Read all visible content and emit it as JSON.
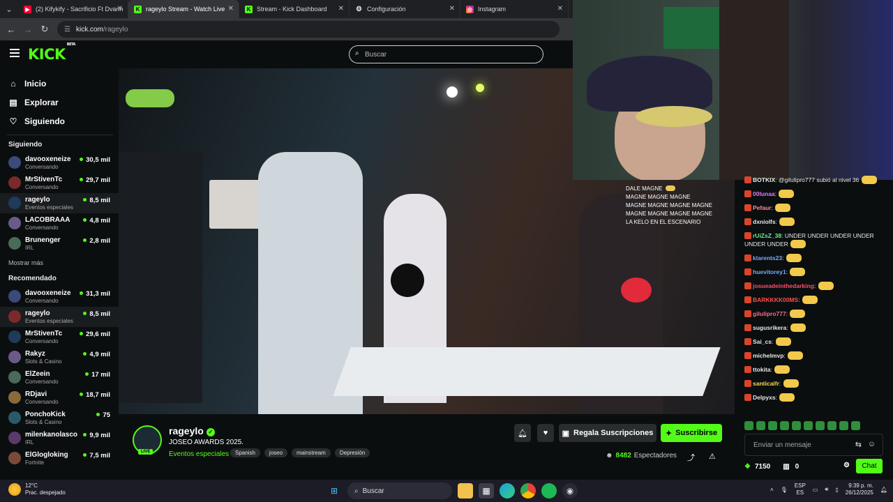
{
  "browser": {
    "tabs": [
      {
        "label": "(2) Kifykify - Sacrificio Ft Dvann",
        "icon": "youtube-icon",
        "color": "#ff0033"
      },
      {
        "label": "rageylo Stream - Watch Live",
        "icon": "kick-icon",
        "color": "#53fc18",
        "active": true
      },
      {
        "label": "Stream - Kick Dashboard",
        "icon": "kick-icon",
        "color": "#53fc18"
      },
      {
        "label": "Configuración",
        "icon": "gear-icon",
        "color": "#e8e8e8"
      },
      {
        "label": "Instagram",
        "icon": "instagram-icon",
        "color": "#e1306c"
      }
    ],
    "url_host": "kick.com",
    "url_path": "/rageylo"
  },
  "kick": {
    "logo": "KICK",
    "logo_badge": "BETA",
    "search_placeholder": "Buscar"
  },
  "sidebar": {
    "nav": [
      {
        "label": "Inicio",
        "icon": "home-icon"
      },
      {
        "label": "Explorar",
        "icon": "compass-icon"
      },
      {
        "label": "Siguiendo",
        "icon": "heart-icon"
      }
    ],
    "following_title": "Siguiendo",
    "following": [
      {
        "name": "davooxeneize",
        "category": "Conversando",
        "viewers": "30,5 mil"
      },
      {
        "name": "MrStivenTc",
        "category": "Conversando",
        "viewers": "29,7 mil"
      },
      {
        "name": "rageylo",
        "category": "Eventos especiales",
        "viewers": "8,5 mil"
      },
      {
        "name": "LACOBRAAA",
        "category": "Conversando",
        "viewers": "4,8 mil"
      },
      {
        "name": "Brunenger",
        "category": "IRL",
        "viewers": "2,8 mil"
      }
    ],
    "show_more": "Mostrar más",
    "recommended_title": "Recomendado",
    "recommended": [
      {
        "name": "davooxeneize",
        "category": "Conversando",
        "viewers": "31,3 mil"
      },
      {
        "name": "rageylo",
        "category": "Eventos especiales",
        "viewers": "8,5 mil"
      },
      {
        "name": "MrStivenTc",
        "category": "Conversando",
        "viewers": "29,6 mil"
      },
      {
        "name": "Rakyz",
        "category": "Slots & Casino",
        "viewers": "4,9 mil"
      },
      {
        "name": "ElZeein",
        "category": "Conversando",
        "viewers": "17 mil"
      },
      {
        "name": "RDjavi",
        "category": "Conversando",
        "viewers": "18,7 mil"
      },
      {
        "name": "PonchoKick",
        "category": "Slots & Casino",
        "viewers": "75"
      },
      {
        "name": "milenkanolasco",
        "category": "IRL",
        "viewers": "9,9 mil"
      },
      {
        "name": "ElGlogloking",
        "category": "Fortnite",
        "viewers": "7,5 mil"
      }
    ]
  },
  "video_overlay": {
    "lines": [
      "DALE MAGNE",
      "MAGNE MAGNE MAGNE",
      "MAGNE MAGNE MAGNE MAGNE",
      "MAGNE MAGNE MAGNE MAGNE",
      "LA KELO EN EL ESCENARIO"
    ]
  },
  "chat": {
    "messages": [
      {
        "user": "BOTKIX",
        "text": "@gilulipro777 subió al nivel 36",
        "color": "#e8e8e8"
      },
      {
        "user": "00lunaa",
        "text": "",
        "color": "#e07bff"
      },
      {
        "user": "Pefaur",
        "text": "",
        "color": "#ff8ba0"
      },
      {
        "user": "dxniolfs",
        "text": "",
        "color": "#e8e8e8"
      },
      {
        "user": "rUiZsZ_38",
        "text": "UNDER UNDER UNDER UNDER UNDER UNDER",
        "color": "#6cf08a"
      },
      {
        "user": "klarents23",
        "text": "",
        "color": "#7aa8ff"
      },
      {
        "user": "huevitorey1",
        "text": "",
        "color": "#7aa8ff"
      },
      {
        "user": "josueadeinthedarking",
        "text": "",
        "color": "#ff4d6d"
      },
      {
        "user": "BARKKKK00MS",
        "text": "",
        "color": "#ff4d4d"
      },
      {
        "user": "gilulipro777",
        "text": "",
        "color": "#ff6b8a"
      },
      {
        "user": "sugusrikera",
        "text": "",
        "color": "#e8e8e8"
      },
      {
        "user": "Sai_cs",
        "text": "",
        "color": "#e8e8e8"
      },
      {
        "user": "michelmvp",
        "text": "",
        "color": "#e8e8e8"
      },
      {
        "user": "ttokita",
        "text": "",
        "color": "#e8e8e8"
      },
      {
        "user": "santicaifr",
        "text": "",
        "color": "#ffd84d"
      },
      {
        "user": "Delpyxs",
        "text": "",
        "color": "#e8e8e8"
      }
    ],
    "input_placeholder": "Enviar un mensaje",
    "points": "7150",
    "cart_count": "0",
    "chat_button": "Chat"
  },
  "stream": {
    "name": "rageylo",
    "title": "JOSEO AWARDS 2025.",
    "category": "Eventos especiales",
    "tags": [
      "Spanish",
      "joseo",
      "mainstream",
      "Depresión"
    ],
    "live_badge": "LIVE",
    "gift_label": "Regala Suscripciones",
    "subscribe_label": "Suscribirse",
    "viewers": "8482",
    "viewers_label": "Espectadores"
  },
  "taskbar": {
    "temp": "12°C",
    "weather": "Prac. despejado",
    "search": "Buscar",
    "lang_top": "ESP",
    "lang_bottom": "ES",
    "time": "9:39 p. m.",
    "date": "26/12/2025"
  }
}
